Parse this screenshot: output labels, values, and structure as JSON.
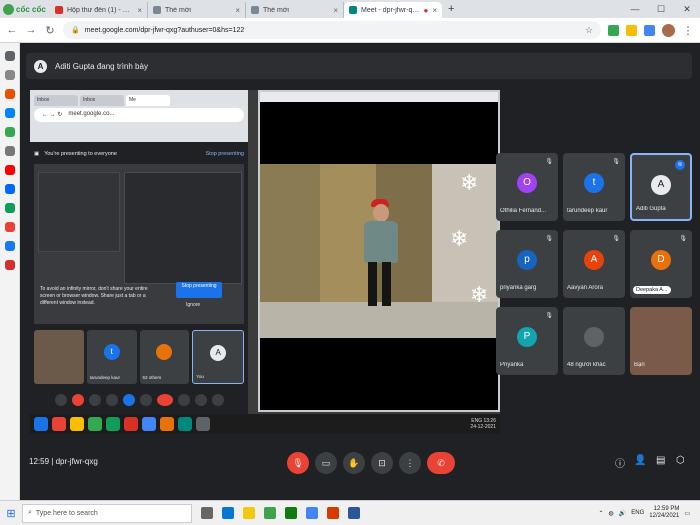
{
  "browser": {
    "brand": "cốc cốc",
    "tabs": [
      {
        "label": "Hộp thư đến (1) - binh2005",
        "color": "#d93025",
        "active": false
      },
      {
        "label": "Thẻ mới",
        "color": "#7b8794",
        "active": false
      },
      {
        "label": "Thẻ mới",
        "color": "#7b8794",
        "active": false
      },
      {
        "label": "Meet - dpr-jfwr-qxg",
        "color": "#00897b",
        "active": true
      }
    ],
    "new_tab": "+",
    "url": "meet.google.com/dpr-jfwr-qxg?authuser=0&hs=122"
  },
  "meet": {
    "presenter_banner": "Aditi Gupta đang trình bày",
    "presenter_initial": "A",
    "meeting_code": "dpr-jfwr-qxg",
    "time": "12:59"
  },
  "shared_screen": {
    "inner_tabs": [
      "Inbox",
      "Inbox",
      "Me"
    ],
    "inner_url": "meet.google.co...",
    "presenting_text": "You're presenting to everyone",
    "stop_presenting_link": "Stop presenting",
    "warning_text": "To avoid an infinity mirror, don't share your entire screen or browser window. Share just a tab or a different window instead.",
    "stop_button": "Stop presenting",
    "ignore_label": "Ignore",
    "inner_tiles": [
      {
        "name": "",
        "initial": "",
        "color": "#6b5a4a"
      },
      {
        "name": "tarundeep kaur",
        "initial": "t",
        "color": "#1a73e8"
      },
      {
        "name": "53 others",
        "initial": "",
        "color": "#e8710a"
      },
      {
        "name": "You",
        "initial": "A",
        "color": "#202124"
      }
    ],
    "tray_lang": "ENG",
    "tray_time": "13:26",
    "tray_date": "24-12-2021"
  },
  "participants": [
    {
      "name": "Othilia Fernand...",
      "initial": "O",
      "color": "#a142f4",
      "active": false
    },
    {
      "name": "tarundeep kaur",
      "initial": "t",
      "color": "#1a73e8",
      "active": false
    },
    {
      "name": "Aditi Gupta",
      "initial": "A",
      "color": "#e8eaed",
      "active": true
    },
    {
      "name": "priyanka garg",
      "initial": "p",
      "color": "#1565c0",
      "active": false
    },
    {
      "name": "Aavyan Arora",
      "initial": "A",
      "color": "#e8430a",
      "active": false
    },
    {
      "name": "Deepaka A...",
      "initial": "D",
      "color": "#e8710a",
      "active": false
    },
    {
      "name": "Priyanka",
      "initial": "P",
      "color": "#12a4af",
      "active": false
    },
    {
      "name": "48 người khác",
      "initial": "",
      "color": "#5f6368",
      "active": false
    },
    {
      "name": "Bạn",
      "initial": "",
      "color": "#7a5a48",
      "active": false
    }
  ],
  "taskbar": {
    "search_placeholder": "Type here to search",
    "lang": "ENG",
    "time": "12:59 PM",
    "date": "12/24/2021"
  }
}
